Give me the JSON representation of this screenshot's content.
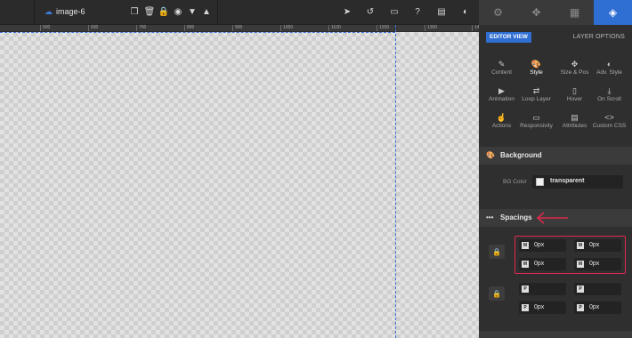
{
  "topbar": {
    "layer_name": "image-6"
  },
  "ruler": {
    "ticks": [
      "500",
      "600",
      "700",
      "800",
      "900",
      "1000",
      "1100",
      "1200",
      "1300",
      "14"
    ]
  },
  "panel": {
    "editor_view": "EDITOR VIEW",
    "layer_options": "LAYER OPTIONS",
    "grid": [
      {
        "label": "Content",
        "icon": "pencil-icon"
      },
      {
        "label": "Style",
        "icon": "palette-icon"
      },
      {
        "label": "Size & Pos",
        "icon": "move-icon"
      },
      {
        "label": "Adv. Style",
        "icon": "contrast-icon"
      },
      {
        "label": "Animation",
        "icon": "play-icon"
      },
      {
        "label": "Loop Layer",
        "icon": "loop-icon"
      },
      {
        "label": "Hover",
        "icon": "mouse-icon"
      },
      {
        "label": "On Scroll",
        "icon": "scroll-icon"
      },
      {
        "label": "Actions",
        "icon": "hand-icon"
      },
      {
        "label": "Responsivity",
        "icon": "monitor-icon"
      },
      {
        "label": "Attributes",
        "icon": "file-icon"
      },
      {
        "label": "Custom CSS",
        "icon": "code-icon"
      }
    ],
    "background": {
      "title": "Background",
      "bg_color_label": "BG Color",
      "bg_color_value": "transparent"
    },
    "spacings": {
      "title": "Spacings",
      "margin": {
        "top": {
          "tag": "M",
          "value": "0px"
        },
        "right": {
          "tag": "M",
          "value": "0px"
        },
        "bottom": {
          "tag": "M",
          "value": "0px"
        },
        "left": {
          "tag": "M",
          "value": "0px"
        }
      },
      "padding": {
        "top": {
          "tag": "P",
          "value": ""
        },
        "right": {
          "tag": "P",
          "value": ""
        },
        "bottom": {
          "tag": "P",
          "value": "0px"
        },
        "left": {
          "tag": "P",
          "value": "0px"
        }
      }
    }
  },
  "colors": {
    "accent": "#2f6ed3",
    "highlight": "#e0294f"
  }
}
